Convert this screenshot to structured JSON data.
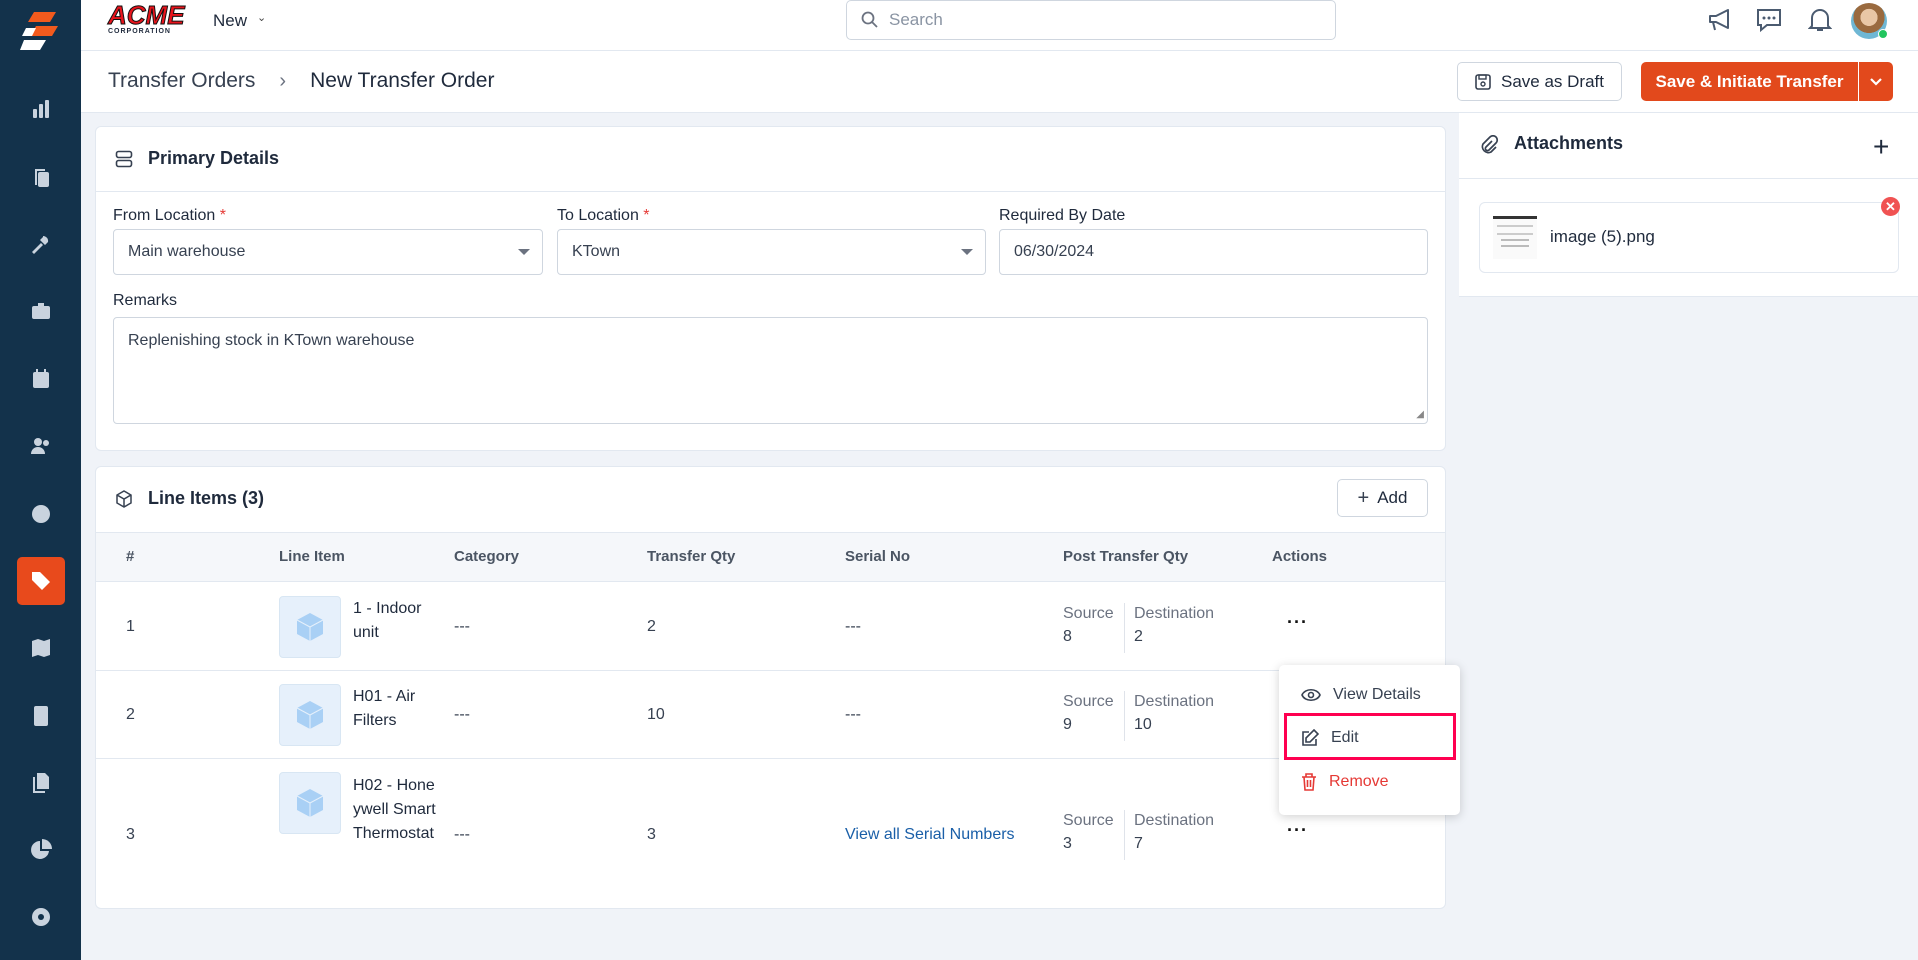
{
  "topbar": {
    "logo_text": "ACME",
    "logo_subtext": "CORPORATION",
    "new_label": "New",
    "search_placeholder": "Search"
  },
  "breadcrumb": {
    "parent": "Transfer Orders",
    "current": "New Transfer Order"
  },
  "actions": {
    "save_draft": "Save as Draft",
    "save_initiate": "Save & Initiate Transfer"
  },
  "primary": {
    "title": "Primary Details",
    "from_label": "From Location",
    "from_value": "Main warehouse",
    "to_label": "To Location",
    "to_value": "KTown",
    "date_label": "Required By Date",
    "date_value": "06/30/2024",
    "remarks_label": "Remarks",
    "remarks_value": "Replenishing stock in KTown warehouse",
    "required_mark": "*"
  },
  "line_items": {
    "title": "Line Items (3)",
    "add_label": "Add",
    "columns": [
      "#",
      "Line Item",
      "Category",
      "Transfer Qty",
      "Serial No",
      "Post Transfer Qty",
      "Actions"
    ],
    "source_label": "Source",
    "dest_label": "Destination",
    "rows": [
      {
        "num": "1",
        "item": "1 - Indoor unit",
        "category": "---",
        "qty": "2",
        "serial": "---",
        "source": "8",
        "dest": "2"
      },
      {
        "num": "2",
        "item": "H01 - Air Filters",
        "category": "---",
        "qty": "10",
        "serial": "---",
        "source": "9",
        "dest": "10"
      },
      {
        "num": "3",
        "item": "H02 - Honeywell Smart Thermostat",
        "category": "---",
        "qty": "3",
        "serial": "View all Serial Numbers",
        "source": "3",
        "dest": "7"
      }
    ]
  },
  "menu": {
    "view": "View Details",
    "edit": "Edit",
    "remove": "Remove"
  },
  "attachments": {
    "title": "Attachments",
    "file": "image (5).png"
  },
  "colors": {
    "accent": "#e84a1c",
    "sidebar": "#13324b",
    "highlight": "#ff0050",
    "danger": "#e53935",
    "link": "#1a5fa8"
  }
}
